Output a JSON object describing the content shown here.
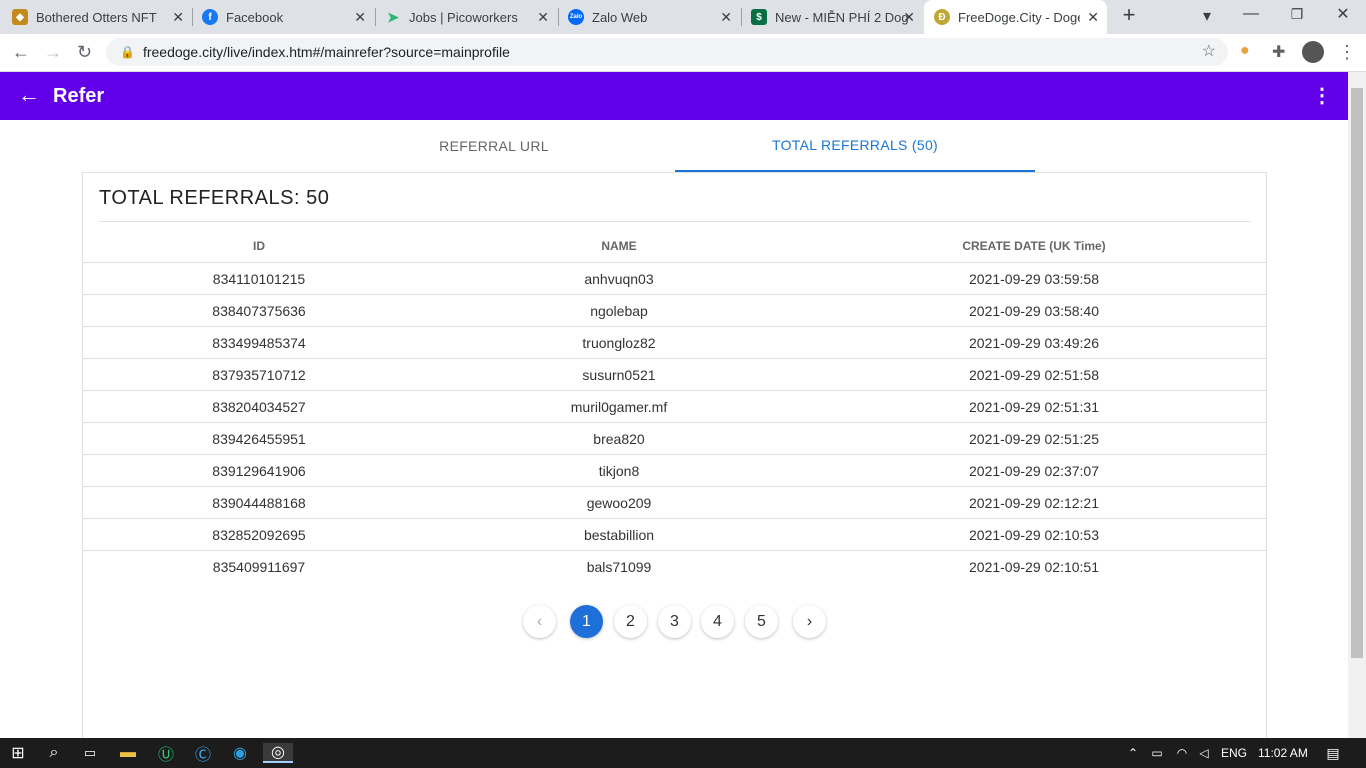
{
  "browser": {
    "tabs": [
      {
        "title": "Bothered Otters NFT",
        "icon": "otter-icon",
        "color": "#c58a1e"
      },
      {
        "title": "Facebook",
        "icon": "facebook-icon",
        "color": "#1877f2"
      },
      {
        "title": "Jobs | Picoworkers",
        "icon": "picoworkers-icon",
        "color": "#2bb673"
      },
      {
        "title": "Zalo Web",
        "icon": "zalo-icon",
        "color": "#0068ff"
      },
      {
        "title": "New - MIỄN PHÍ 2 Dog",
        "icon": "dollar-icon",
        "color": "#0a6e44"
      },
      {
        "title": "FreeDoge.City - Dogec",
        "icon": "doge-icon",
        "color": "#c2a633"
      }
    ],
    "url": "freedoge.city/live/index.htm#/mainrefer?source=mainprofile"
  },
  "appbar": {
    "title": "Refer",
    "color": "#6200ea"
  },
  "tabs": {
    "referral_url": "REFERRAL URL",
    "total_referrals": "TOTAL REFERRALS (50)",
    "active_color": "#1976d2"
  },
  "card": {
    "heading": "TOTAL REFERRALS: 50",
    "columns": [
      "ID",
      "NAME",
      "CREATE DATE (UK Time)"
    ],
    "rows": [
      [
        "834110101215",
        "anhvuqn03",
        "2021-09-29 03:59:58"
      ],
      [
        "838407375636",
        "ngolebap",
        "2021-09-29 03:58:40"
      ],
      [
        "833499485374",
        "truongloz82",
        "2021-09-29 03:49:26"
      ],
      [
        "837935710712",
        "susurn0521",
        "2021-09-29 02:51:58"
      ],
      [
        "838204034527",
        "muril0gamer.mf",
        "2021-09-29 02:51:31"
      ],
      [
        "839426455951",
        "brea820",
        "2021-09-29 02:51:25"
      ],
      [
        "839129641906",
        "tikjon8",
        "2021-09-29 02:37:07"
      ],
      [
        "839044488168",
        "gewoo209",
        "2021-09-29 02:12:21"
      ],
      [
        "832852092695",
        "bestabillion",
        "2021-09-29 02:10:53"
      ],
      [
        "835409911697",
        "bals71099",
        "2021-09-29 02:10:51"
      ]
    ]
  },
  "pagination": {
    "pages": [
      "1",
      "2",
      "3",
      "4",
      "5"
    ],
    "current": "1"
  },
  "taskbar": {
    "language": "ENG",
    "time": "11:02 AM"
  }
}
